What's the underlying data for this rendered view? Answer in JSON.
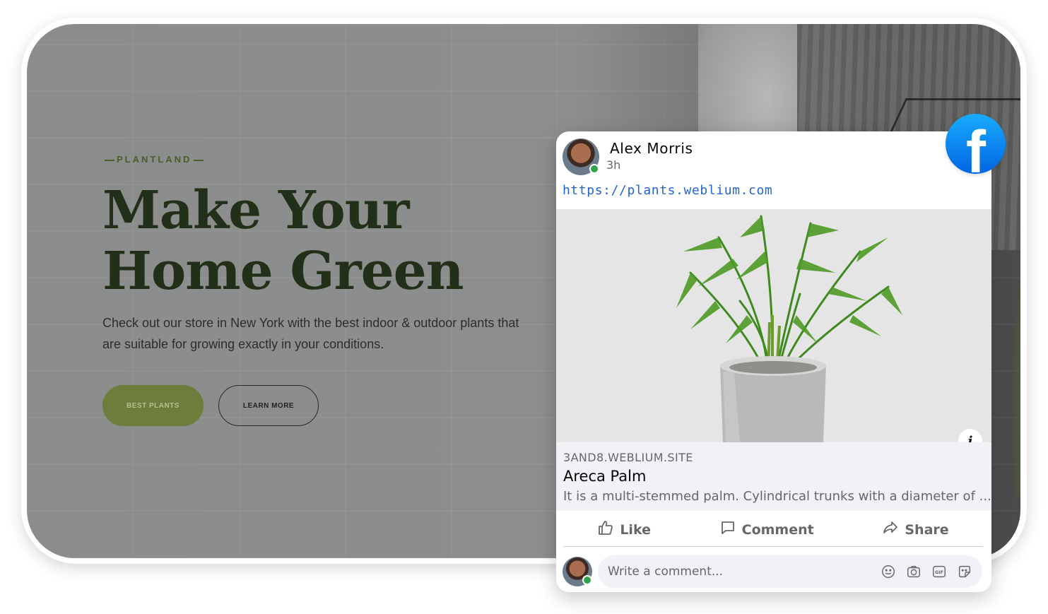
{
  "hero": {
    "eyebrow": "PLANTLAND",
    "headline_line1": "Make Your",
    "headline_line2": "Home Green",
    "description": "Check out our store in New York with the best indoor & outdoor plants that are suitable for growing exactly in your conditions.",
    "primary_button": "BEST PLANTS",
    "secondary_button": "LEARN MORE"
  },
  "post": {
    "author": "Alex Morris",
    "time": "3h",
    "link": "https://plants.weblium.com",
    "preview": {
      "domain": "3AND8.WEBLIUM.SITE",
      "title": "Areca Palm",
      "description": "It is a multi-stemmed palm. Cylindrical trunks with a diameter of ..."
    },
    "actions": {
      "like": "Like",
      "comment": "Comment",
      "share": "Share"
    },
    "comment_placeholder": "Write a comment..."
  },
  "colors": {
    "facebook_blue": "#1877f2",
    "link_blue": "#2264d1",
    "headline_green": "#233019",
    "button_green": "#6d7d3b",
    "online_green": "#31a24c"
  },
  "icons": [
    "facebook-logo-icon",
    "info-icon",
    "like-icon",
    "comment-icon",
    "share-icon",
    "emoji-icon",
    "camera-icon",
    "gif-icon",
    "sticker-icon"
  ]
}
